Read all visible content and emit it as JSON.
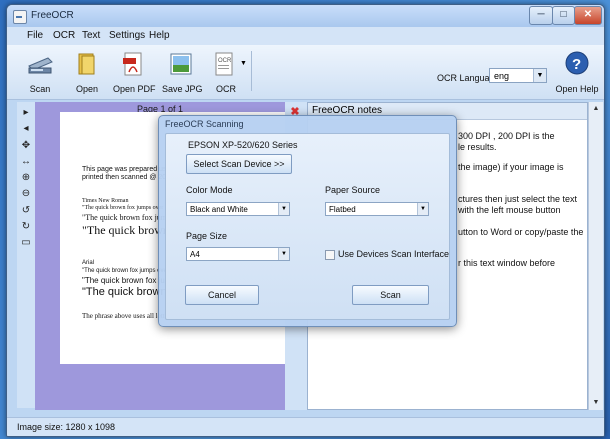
{
  "window": {
    "title": "FreeOCR",
    "minimize": "─",
    "maximize": "□",
    "close": "✕"
  },
  "menu": [
    "File",
    "OCR",
    "Text",
    "Settings",
    "Help"
  ],
  "toolbar": {
    "scan": "Scan",
    "open": "Open",
    "open_pdf": "Open PDF",
    "save_jpg": "Save JPG",
    "ocr": "OCR",
    "ocr_language_label": "OCR Language:",
    "ocr_language_value": "eng",
    "open_help": "Open Help"
  },
  "image_pane": {
    "page_label": "Page 1 of 1",
    "lines": [
      "This page was prepared using Microsoft Word",
      "printed then scanned @ 200 DPI",
      "Times New Roman",
      "\"The quick brown fox jumps over a lazy dog\"",
      "\"The quick brown fox jumps over a lazy dog\"",
      "\"The quick brown fox jumps",
      "Arial",
      "\"The quick brown fox jumps over a lazy dog\"",
      "\"The quick brown fox jumps over a lazy dog\"",
      "\"The quick brown fox jumps",
      "The phrase above uses all letters from"
    ]
  },
  "notes": {
    "title": "FreeOCR notes",
    "lines": [
      "300 DPI , 200 DPI is the",
      "le results.",
      "the image) if your image is",
      "ctures then just select the text",
      "with the left mouse button",
      "utton to Word or copy/paste the",
      "r this text window before"
    ]
  },
  "status": {
    "image_size": "Image size:  1280 x 1098"
  },
  "dialog": {
    "title": "FreeOCR Scanning",
    "device_name": "EPSON XP-520/620 Series",
    "select_device_button": "Select Scan Device >>",
    "color_mode_label": "Color Mode",
    "color_mode_value": "Black and White",
    "paper_source_label": "Paper Source",
    "paper_source_value": "Flatbed",
    "page_size_label": "Page Size",
    "page_size_value": "A4",
    "use_interface_label": "Use Devices Scan Interface",
    "cancel_button": "Cancel",
    "scan_button": "Scan"
  },
  "colors": {
    "image_pane_bg": "#9e98dc",
    "window_chrome": "#bdd6f2",
    "close_button": "#c7452b"
  }
}
